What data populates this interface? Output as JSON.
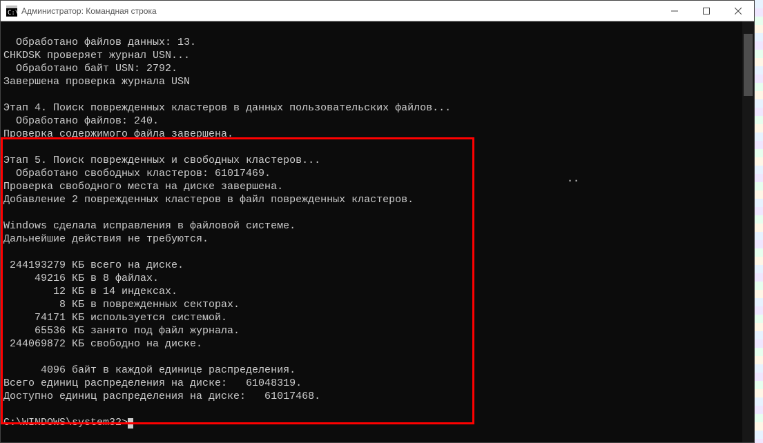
{
  "window": {
    "title": "Администратор: Командная строка"
  },
  "lines": {
    "l0": "  Обработано файлов данных: 13.",
    "l1": "CHKDSK проверяет журнал USN...",
    "l2": "  Обработано байт USN: 2792.",
    "l3": "Завершена проверка журнала USN",
    "l4": "",
    "l5": "Этап 4. Поиск поврежденных кластеров в данных пользовательских файлов...",
    "l6": "  Обработано файлов: 240.",
    "l7": "Проверка содержимого файла завершена.",
    "l8": "",
    "l9": "Этап 5. Поиск поврежденных и свободных кластеров...",
    "l10": "  Обработано свободных кластеров: 61017469.",
    "l11": "Проверка свободного места на диске завершена.",
    "l12": "Добавление 2 поврежденных кластеров в файл поврежденных кластеров.",
    "l13": "",
    "l14": "Windows сделала исправления в файловой системе.",
    "l15": "Дальнейшие действия не требуются.",
    "l16": "",
    "l17": " 244193279 КБ всего на диске.",
    "l18": "     49216 КБ в 8 файлах.",
    "l19": "        12 КБ в 14 индексах.",
    "l20": "         8 КБ в поврежденных секторах.",
    "l21": "     74171 КБ используется системой.",
    "l22": "     65536 КБ занято под файл журнала.",
    "l23": " 244069872 КБ свободно на диске.",
    "l24": "",
    "l25": "      4096 байт в каждой единице распределения.",
    "l26": "Всего единиц распределения на диске:   61048319.",
    "l27": "Доступно единиц распределения на диске:   61017468.",
    "l28": "",
    "prompt": "C:\\WINDOWS\\system32>"
  },
  "misc": {
    "dots": ".."
  }
}
